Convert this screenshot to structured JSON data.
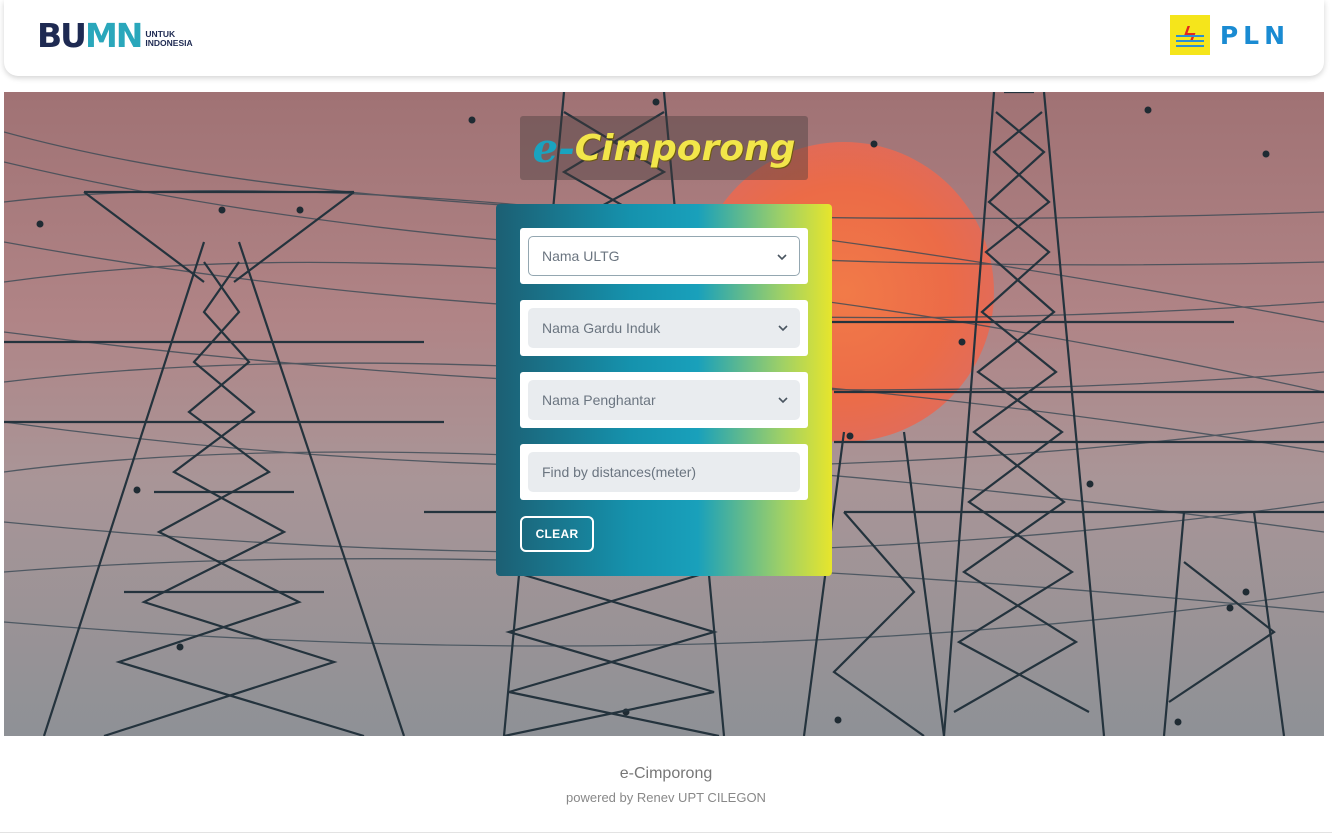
{
  "header": {
    "left_logo": {
      "mark": [
        "B",
        "U",
        "MN"
      ],
      "line1": "UNTUK",
      "line2": "INDONESIA"
    },
    "right_logo": {
      "text": "PLN"
    }
  },
  "hero": {
    "title_prefix": "e-",
    "title_main": "Cimporong"
  },
  "form": {
    "ultg": {
      "placeholder": "Nama ULTG"
    },
    "gardu": {
      "placeholder": "Nama Gardu Induk"
    },
    "penghantar": {
      "placeholder": "Nama Penghantar"
    },
    "distance": {
      "placeholder": "Find by distances(meter)"
    },
    "clear_label": "CLEAR"
  },
  "footer": {
    "title": "e-Cimporong",
    "subtitle": "powered by Renev UPT CILEGON"
  },
  "colors": {
    "brand_navy": "#1e2a52",
    "brand_teal": "#2aa7bb",
    "pln_blue": "#1a8bd2",
    "pln_yellow": "#f5e51b",
    "card_gradient_start": "#1c5f73",
    "card_gradient_end": "#e7e52c"
  },
  "icons": [
    "chevron-down-icon",
    "lightning-bolt-icon"
  ]
}
